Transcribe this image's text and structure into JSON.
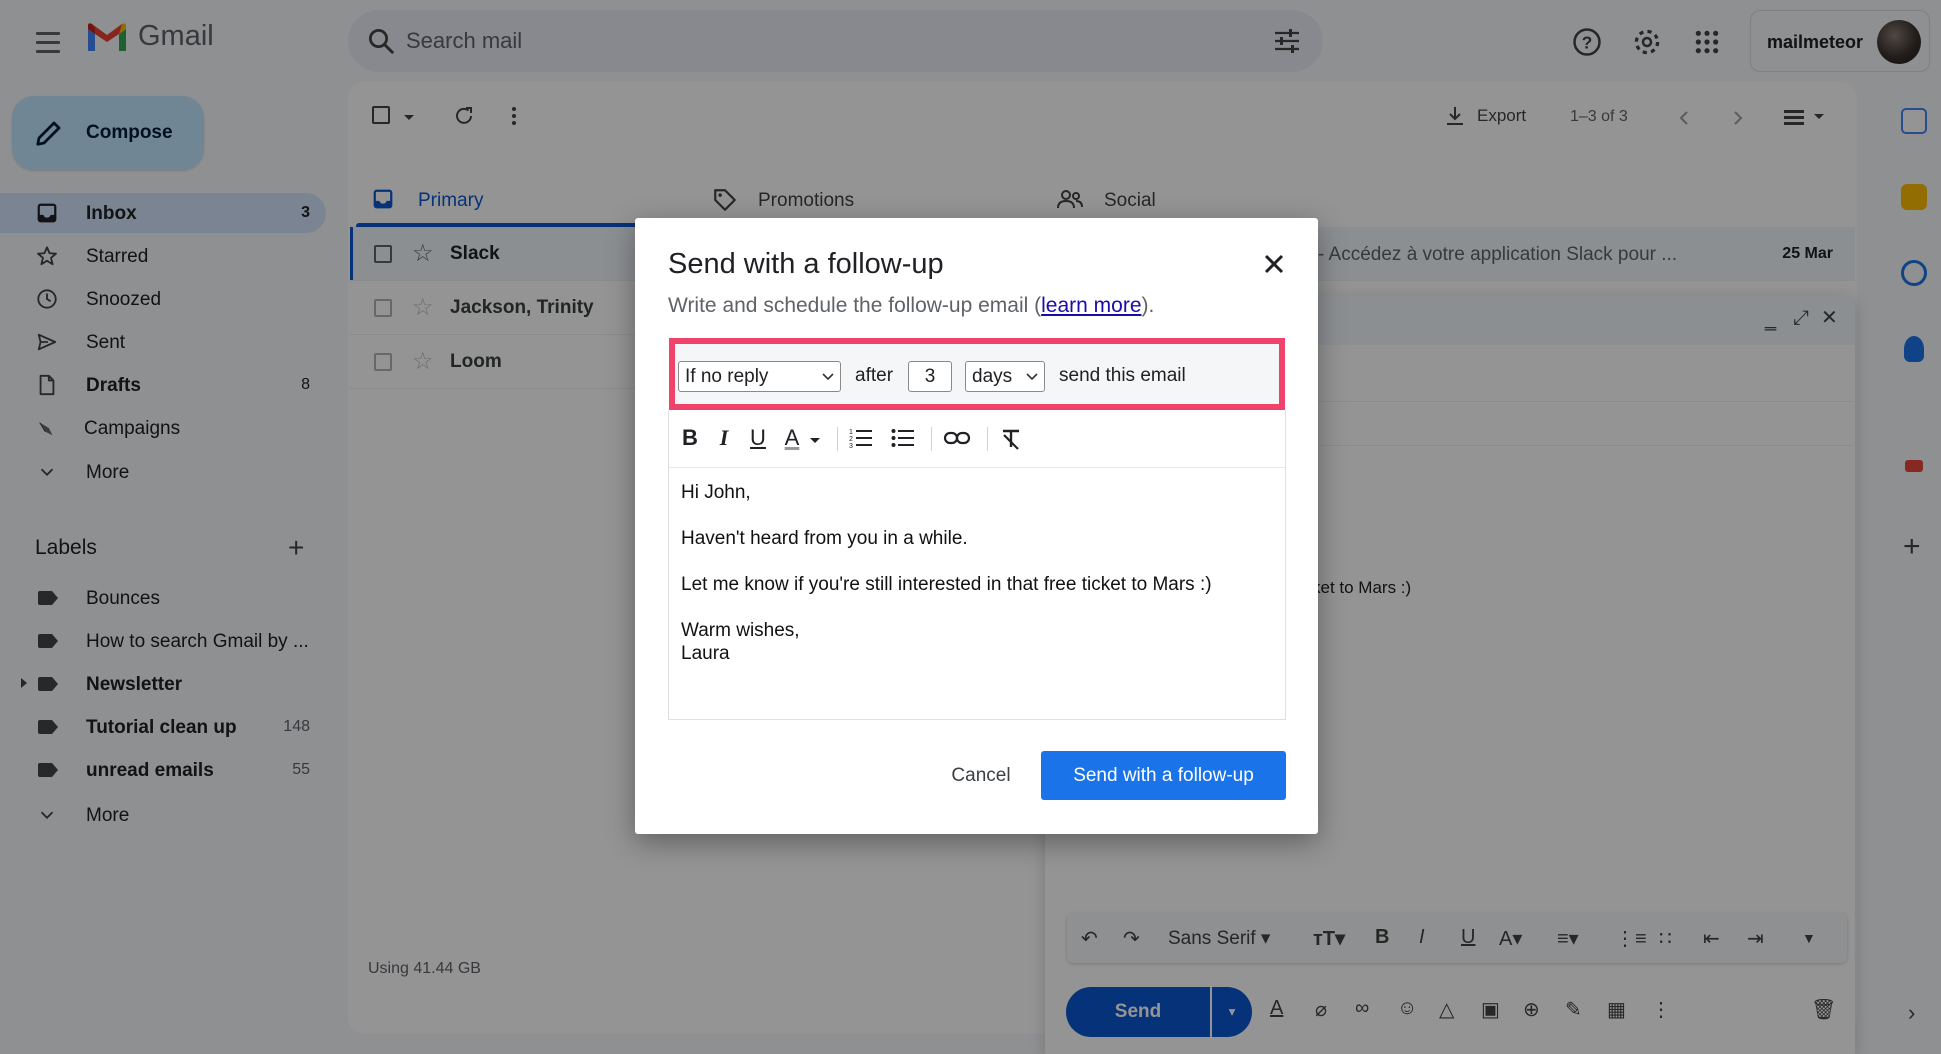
{
  "header": {
    "logo_text": "Gmail",
    "search_placeholder": "Search mail",
    "account_name": "mailmeteor"
  },
  "compose_label": "Compose",
  "nav": [
    {
      "label": "Inbox",
      "count": "3",
      "bold": true,
      "active": true,
      "icon": "inbox-icon"
    },
    {
      "label": "Starred",
      "count": "",
      "icon": "star-icon"
    },
    {
      "label": "Snoozed",
      "count": "",
      "icon": "clock-icon"
    },
    {
      "label": "Sent",
      "count": "",
      "icon": "send-icon"
    },
    {
      "label": "Drafts",
      "count": "8",
      "bold": true,
      "icon": "draft-icon"
    },
    {
      "label": "Campaigns",
      "count": "",
      "icon": "campaign-icon"
    },
    {
      "label": "More",
      "count": "",
      "icon": "chevron-down-icon"
    }
  ],
  "labels": {
    "heading": "Labels",
    "items": [
      {
        "label": "Bounces",
        "count": ""
      },
      {
        "label": "How to search Gmail by ...",
        "count": ""
      },
      {
        "label": "Newsletter",
        "count": "",
        "bold": true
      },
      {
        "label": "Tutorial clean up",
        "count": "148",
        "bold": true
      },
      {
        "label": "unread emails",
        "count": "55",
        "bold": true
      }
    ],
    "more": "More"
  },
  "toolbar": {
    "export_label": "Export",
    "pager": "1–3 of 3"
  },
  "tabs": [
    {
      "label": "Primary",
      "icon": "inbox-icon"
    },
    {
      "label": "Promotions",
      "icon": "tag-icon"
    },
    {
      "label": "Social",
      "icon": "people-icon"
    }
  ],
  "emails": [
    {
      "sender": "Slack",
      "snippet": "- Accédez à votre application Slack pour ...",
      "date": "25 Mar",
      "unread": true
    },
    {
      "sender": "Jackson, Trinity",
      "snippet": "",
      "date": "",
      "unread": false
    },
    {
      "sender": "Loom",
      "snippet": "",
      "date": "",
      "unread": false
    }
  ],
  "storage": "Using 41.44 GB",
  "compose_window": {
    "body_fragment": "ket to Mars :)",
    "font_name": "Sans Serif",
    "send_label": "Send"
  },
  "modal": {
    "title": "Send with a follow-up",
    "subtitle_pre": "Write and schedule the follow-up email (",
    "subtitle_link": "learn more",
    "subtitle_post": ").",
    "condition": "If no reply",
    "after_label": "after",
    "delay_value": "3",
    "unit": "days",
    "send_text": "send this email",
    "body": {
      "greeting": "Hi John,",
      "line1": "Haven't heard from you in a while.",
      "line2": "Let me know if you're still interested in that free ticket to Mars :)",
      "closing": "Warm wishes,",
      "signature": "Laura"
    },
    "cancel_label": "Cancel",
    "submit_label": "Send with a follow-up"
  },
  "colors": {
    "accent_blue": "#1a73e8",
    "highlight_pink": "#f0436b",
    "nav_active": "#d3e3fd",
    "compose_bg": "#c2e7ff"
  }
}
